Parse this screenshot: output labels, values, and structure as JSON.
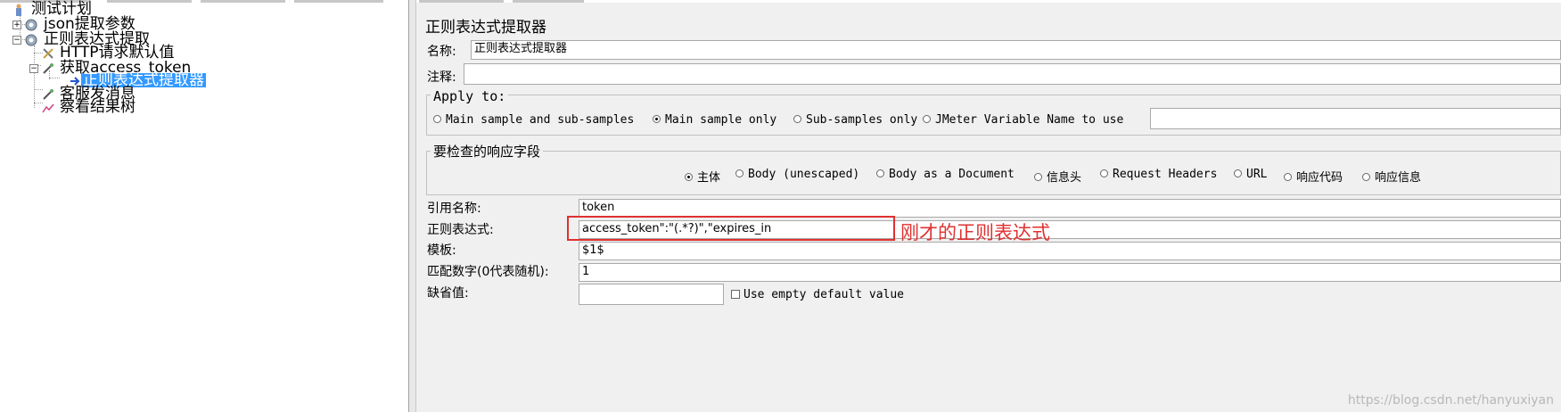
{
  "tree": {
    "items": [
      {
        "label": "测试计划",
        "icon": "test-plan-icon"
      },
      {
        "label": "json提取参数",
        "icon": "thread-group-icon"
      },
      {
        "label": "正则表达式提取",
        "icon": "thread-group-icon"
      },
      {
        "label": "HTTP请求默认值",
        "icon": "config-wrench-icon"
      },
      {
        "label": "获取access_token",
        "icon": "sampler-pipette-icon"
      },
      {
        "label": "正则表达式提取器",
        "icon": "post-processor-arrow-icon",
        "selected": true
      },
      {
        "label": "客服发消息",
        "icon": "sampler-pipette-icon"
      },
      {
        "label": "察看结果树",
        "icon": "listener-graph-icon"
      }
    ],
    "selected_color": "#3399ff"
  },
  "panel": {
    "title": "正则表达式提取器",
    "name_label": "名称:",
    "name_value": "正则表达式提取器",
    "comments_label": "注释:",
    "comments_value": "",
    "apply_to": {
      "title": "Apply to:",
      "options": [
        "Main sample and sub-samples",
        "Main sample only",
        "Sub-samples only",
        "JMeter Variable Name to use"
      ],
      "selected": "Main sample only",
      "variable_value": ""
    },
    "response_field": {
      "title": "要检查的响应字段",
      "options": [
        "主体",
        "Body (unescaped)",
        "Body as a Document",
        "信息头",
        "Request Headers",
        "URL",
        "响应代码",
        "响应信息"
      ],
      "selected": "主体"
    },
    "ref_name_label": "引用名称:",
    "ref_name_value": "token",
    "regex_label": "正则表达式:",
    "regex_value": "access_token\":\"(.*?)\",\"expires_in",
    "template_label": "模板:",
    "template_value": "$1$",
    "match_no_label": "匹配数字(0代表随机):",
    "match_no_value": "1",
    "default_label": "缺省值:",
    "default_value": "",
    "use_empty_label": "Use empty default value",
    "use_empty_checked": false
  },
  "annotation": {
    "text": "刚才的正则表达式",
    "color": "#e03030"
  },
  "watermark": "https://blog.csdn.net/hanyuxiyan"
}
